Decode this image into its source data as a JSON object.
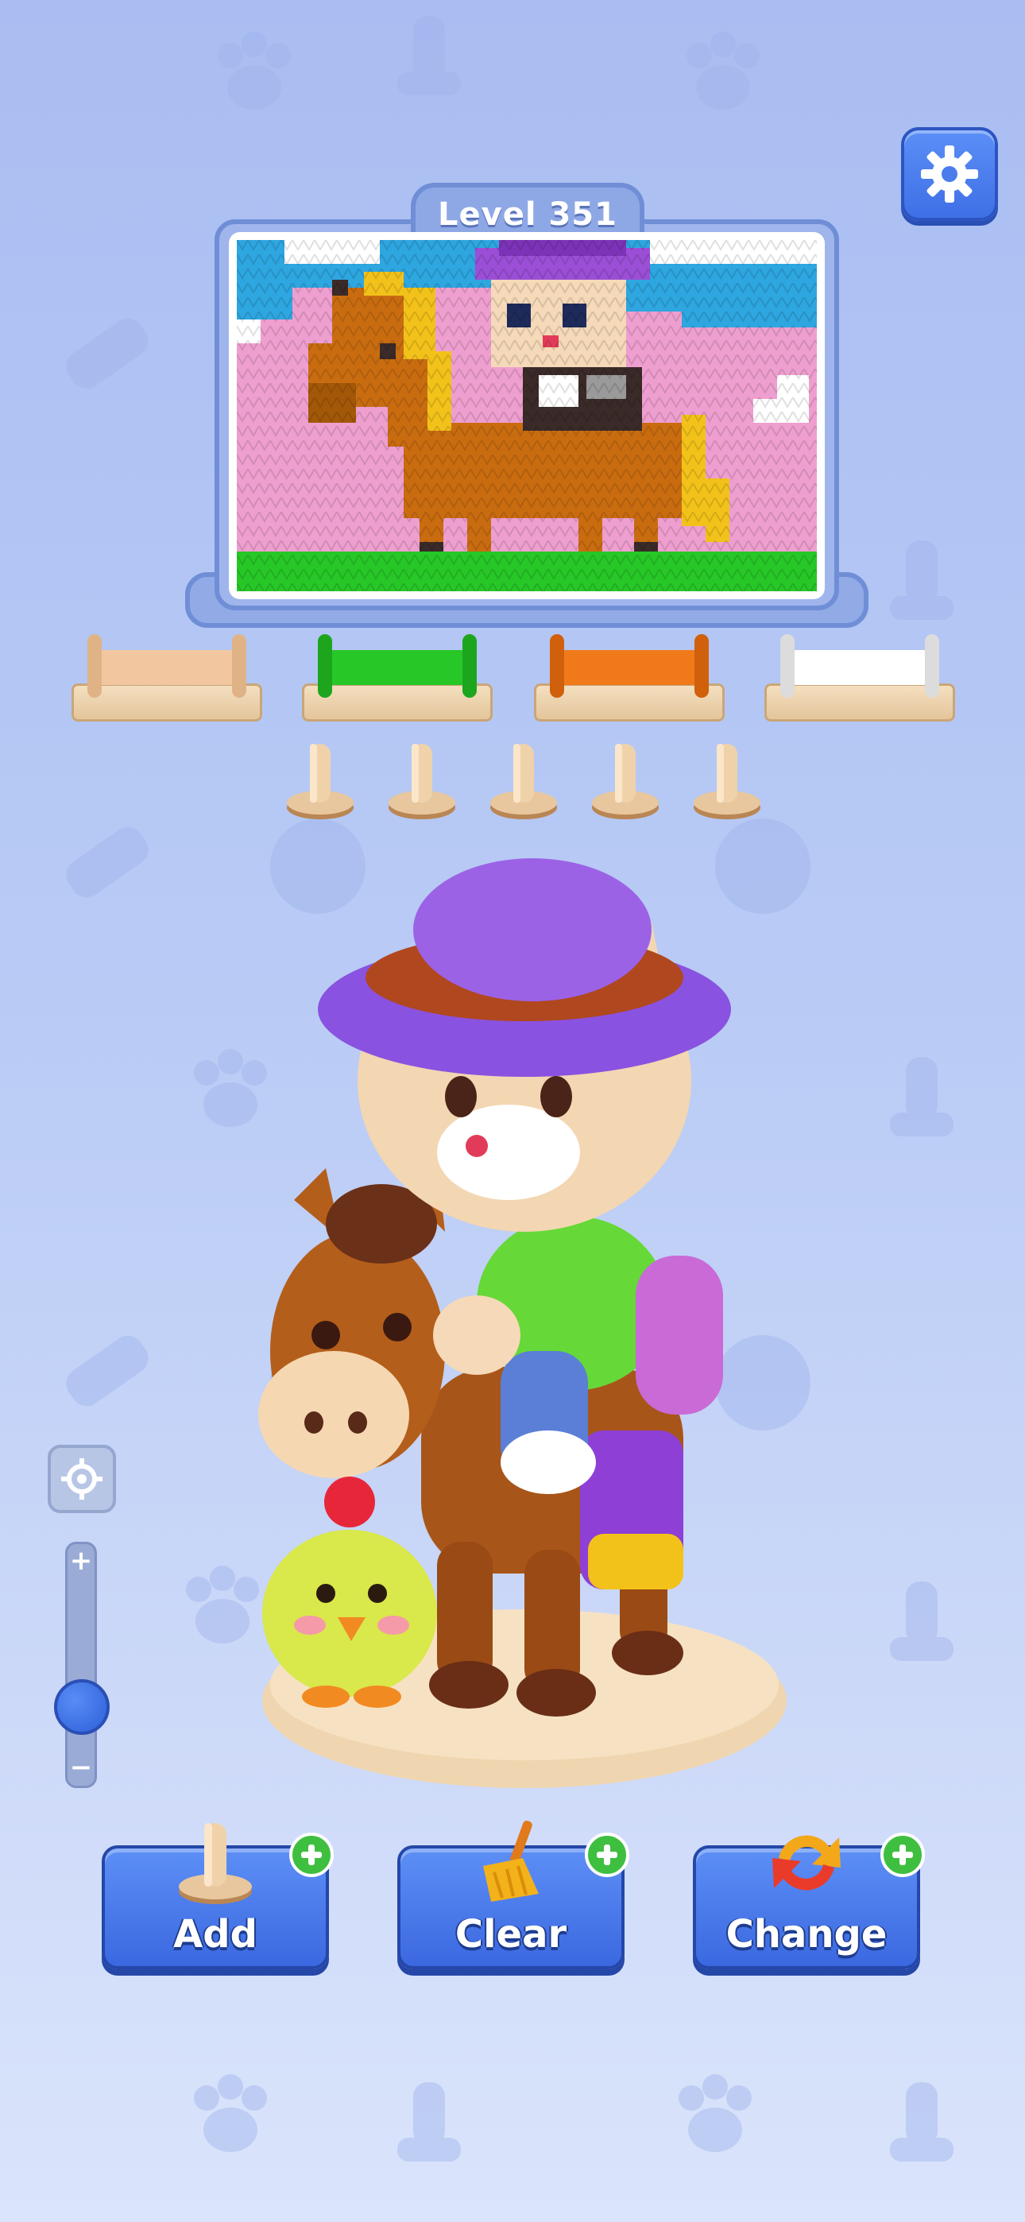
{
  "level": {
    "label": "Level 351"
  },
  "settings": {
    "icon": "gear-icon"
  },
  "spools": [
    {
      "color": "#f2c7a0",
      "end": "#d8a877"
    },
    {
      "color": "#27c727",
      "end": "#1ea51e"
    },
    {
      "color": "#f07a1a",
      "end": "#d0600b"
    },
    {
      "color": "#ffffff",
      "end": "#d9d9d9"
    }
  ],
  "pegs": {
    "count": 5
  },
  "zoom": {
    "plus": "+",
    "minus": "−",
    "level": 0.3
  },
  "actions": [
    {
      "label": "Add",
      "icon": "peg-icon"
    },
    {
      "label": "Clear",
      "icon": "broom-icon"
    },
    {
      "label": "Change",
      "icon": "swap-arrows-icon"
    }
  ],
  "colors": {
    "pink": "#ee9fcf",
    "sky": "#2ea6e0",
    "grass": "#27c727",
    "horse": "#c96c10",
    "mane": "#f3c21a",
    "dark": "#3a2a28",
    "purple": "#9b4fd6",
    "white": "#ffffff"
  }
}
